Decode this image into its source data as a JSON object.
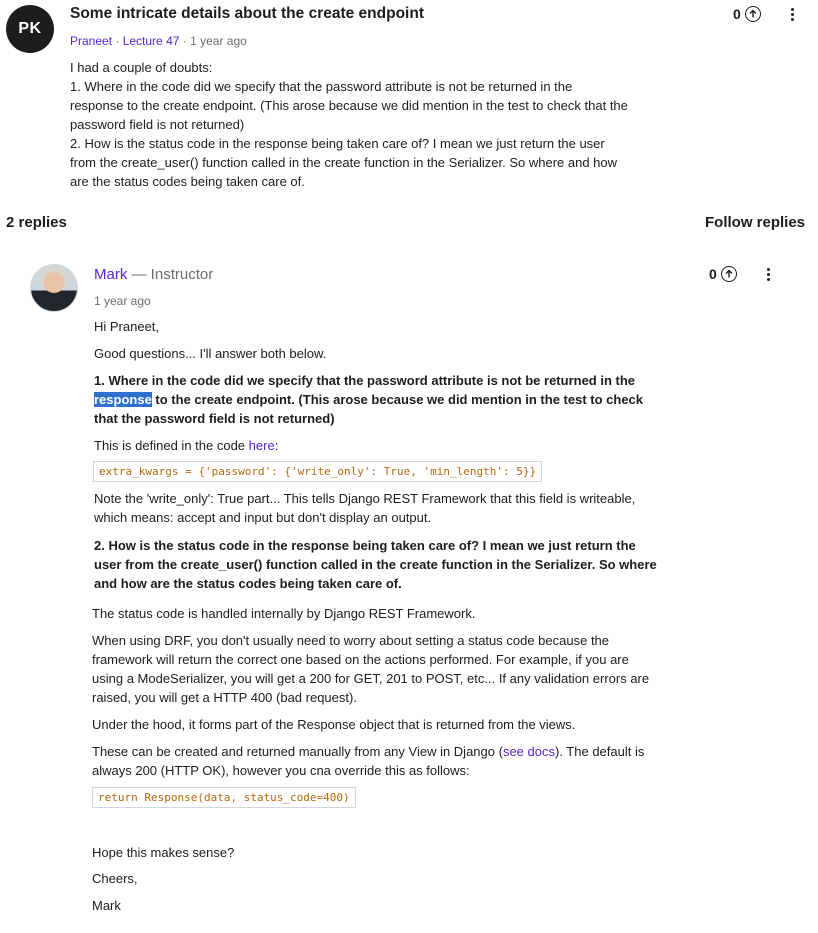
{
  "question": {
    "avatar_initials": "PK",
    "title": "Some intricate details about the create endpoint",
    "author": "Praneet",
    "lecture": "Lecture 47",
    "time": "1 year ago",
    "votes": "0",
    "body": [
      "I had a couple of doubts:",
      "1. Where in the code did we specify that the password attribute is not be returned in the",
      "response to the create endpoint. (This arose because we did mention in the test to check that the",
      "password field is not returned)",
      "2. How is the status code in the response being taken care of? I mean we just return the user",
      "from the create_user() function called in the create function in the Serializer. So where and how",
      "are the status codes being taken care of."
    ]
  },
  "replies_header": {
    "count_label": "2 replies",
    "follow_label": "Follow replies"
  },
  "reply": {
    "name": "Mark",
    "role": "— Instructor",
    "time": "1 year ago",
    "votes": "0",
    "greeting": "Hi Praneet,",
    "intro": "Good questions... I'll answer both below.",
    "q1": {
      "line1": "1. Where in the code did we specify that the password attribute is not be returned in the",
      "highlight": "response",
      "line2_rest": " to the create endpoint. (This arose because we did mention in the test to check",
      "line3": "that the password field is not returned)"
    },
    "defined_text": "This is defined in the code ",
    "defined_link": "here",
    "defined_end": ":",
    "code1": "extra_kwargs = {'password': {'write_only': True, 'min_length': 5}}",
    "note1": "Note the 'write_only': True part... This tells Django REST Framework that this field is writeable,",
    "note2": "which means: accept and input but don't display an output.",
    "q2": {
      "line1": "2. How is the status code in the response being taken care of? I mean we just return the",
      "line2": "user from the create_user() function called in the create function in the Serializer. So where",
      "line3": "and how are the status codes being taken care of."
    },
    "p_handled": "The status code is handled internally by Django REST Framework.",
    "p_drf": [
      "When using DRF, you don't usually need to worry about setting a status code because the",
      "framework will return the correct one based on the actions performed. For example, if you are",
      "using a ModeSerializer, you will get a 200 for GET, 201 to POST, etc... If any validation errors are",
      "raised, you will get a HTTP 400 (bad request)."
    ],
    "p_hood": "Under the hood, it forms part of the Response object that is returned from the views.",
    "p_manual_1": "These can be created and returned manually from any View in Django (",
    "p_manual_link": "see docs",
    "p_manual_2": "). The default is",
    "p_manual_3": "always 200 (HTTP OK), however you cna override this as follows:",
    "code2": "return Response(data, status_code=400)",
    "closing1": "Hope this makes sense?",
    "closing2": "Cheers,",
    "closing3": "Mark"
  }
}
